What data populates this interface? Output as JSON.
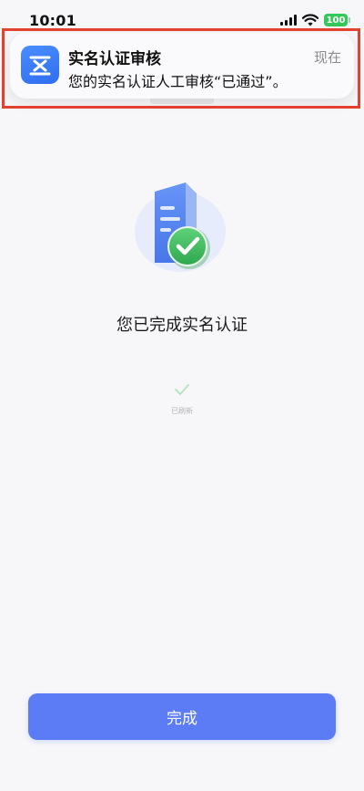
{
  "status_bar": {
    "time": "10:01",
    "battery": "100"
  },
  "notification": {
    "app_icon": "verification-app-icon",
    "title": "实名认证审核",
    "body": "您的实名认证人工审核“已通过”。",
    "time": "现在",
    "highlight_color": "#e2422f"
  },
  "main": {
    "illustration_icon": "verified-document-check-icon",
    "success_title": "您已完成实名认证",
    "refresh_label": "已刷新"
  },
  "footer": {
    "done_label": "完成",
    "button_color": "#5b7cf5"
  }
}
